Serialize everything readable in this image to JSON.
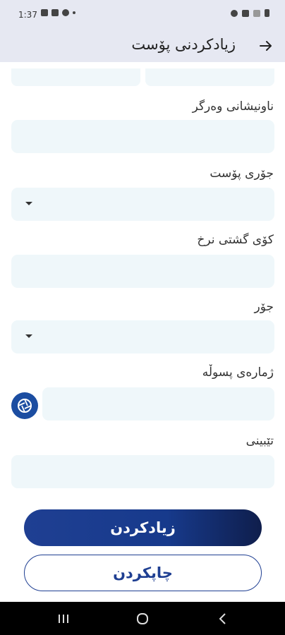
{
  "status_bar": {
    "time": "1:37"
  },
  "header": {
    "title": "زیادکردنی پۆست",
    "back_icon": "arrow-right-icon"
  },
  "form": {
    "receiver_address_label": "ناونیشانی وەرگر",
    "receiver_address_value": "",
    "post_type_label": "جۆری پۆست",
    "post_type_value": "",
    "total_price_label": "کۆی گشتی نرخ",
    "total_price_value": "",
    "kind_label": "جۆر",
    "kind_value": "",
    "receipt_number_label": "ژمارەی پسوڵە",
    "receipt_number_value": "",
    "notes_label": "تێبینی",
    "notes_value": ""
  },
  "actions": {
    "add_label": "زیادکردن",
    "print_label": "چاپکردن"
  },
  "colors": {
    "primary": "#1f3f92",
    "field_bg": "#eff7fa",
    "appbar_bg": "#e6e8f2"
  }
}
